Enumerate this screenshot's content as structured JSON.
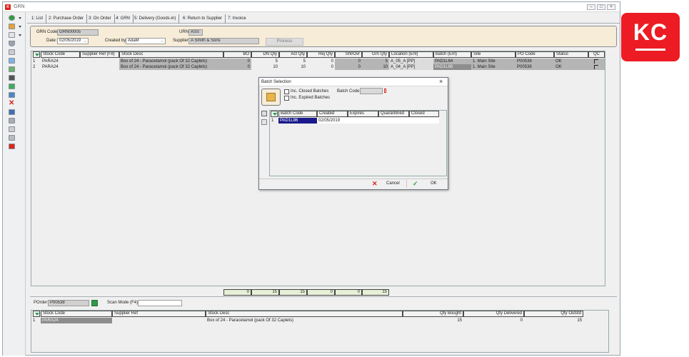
{
  "window": {
    "title": "GRN",
    "logo_text": "KC"
  },
  "tabs": [
    "1: List",
    "2: Purchase Order",
    "3: On Order",
    "4: GRN",
    "5: Delivery (Goods-in)",
    "6: Return to Supplier",
    "7: Invoice"
  ],
  "form": {
    "grn_code_label": "GRN Code:",
    "grn_code": "GRN00005",
    "date_label": "Date:",
    "date": "02/05/2019",
    "created_by_label": "Created by:",
    "created_by": "AdaM",
    "urn_label": "URN:",
    "urn": "ASS",
    "supplier_label": "Supplier:",
    "supplier": "A Smith & Sons",
    "process_label": "Process"
  },
  "grid": {
    "columns": [
      "Stock Code",
      "Supplier Ref (F8)",
      "Stock Desc",
      "BO",
      "DN Qty",
      "Act Qty",
      "Rej Qty",
      "Sht/Ovr",
      "Grn Qty",
      "Location (Ent)",
      "Batch (Ent)",
      "Site",
      "PO Code",
      "Status",
      "QC"
    ],
    "rows": [
      {
        "n": "1",
        "stock_code": "PARA24",
        "supplier_ref": "",
        "desc": "Box of 24 - Paracetamol (pack Of 32 Caplets)",
        "bo": "0",
        "dn": "5",
        "act": "5",
        "rej": "0",
        "sht": "0",
        "grn": "5",
        "location": "A_05_A [PP]",
        "batch": "PAD1L64",
        "site": "1. Main Site",
        "po": "P00538",
        "status": "OK"
      },
      {
        "n": "2",
        "stock_code": "PARA24",
        "supplier_ref": "",
        "desc": "Box of 24 - Paracetamol (pack Of 32 Caplets)",
        "bo": "0",
        "dn": "10",
        "act": "10",
        "rej": "0",
        "sht": "0",
        "grn": "10",
        "location": "A_04_A [PP]",
        "batch": "PAD1L86",
        "site": "1. Main Site",
        "po": "P00538",
        "status": "OK"
      }
    ],
    "totals": [
      "0",
      "15",
      "15",
      "0",
      "0",
      "15"
    ]
  },
  "lower": {
    "porder_label": "POrder:",
    "porder": "P00538",
    "scan_label": "Scan Mode (F4):",
    "scan_value": "",
    "columns": [
      "Stock Code",
      "Supplier Ref",
      "Stock Desc",
      "Qty Bought",
      "Qty Delivered",
      "Qty Outstd"
    ],
    "rows": [
      {
        "n": "1",
        "stock_code": "PARA24",
        "supplier_ref": "",
        "desc": "Box of 24 - Paracetamol (pack Of 32 Caplets)",
        "bought": "15",
        "delivered": "0",
        "outstd": "15"
      }
    ]
  },
  "dialog": {
    "title": "Batch Selection",
    "closed_label": "Inc. Closed Batches",
    "expired_label": "Inc. Expired Batches",
    "batch_code_label": "Batch Code:",
    "columns": [
      "Batch Code",
      "Created",
      "Expires",
      "Quarantined",
      "Closed"
    ],
    "rows": [
      {
        "n": "1",
        "code": "PAD1L86",
        "created": "02/05/2019",
        "expires": "",
        "quarantined": "",
        "closed": ""
      }
    ],
    "cancel_label": "Cancel",
    "ok_label": "OK"
  },
  "colors": {
    "brand": "#ed1c24",
    "form_bg": "#f7ecd8",
    "selected": "#1a1a8c",
    "totals_bg": "#e6f0d6"
  }
}
